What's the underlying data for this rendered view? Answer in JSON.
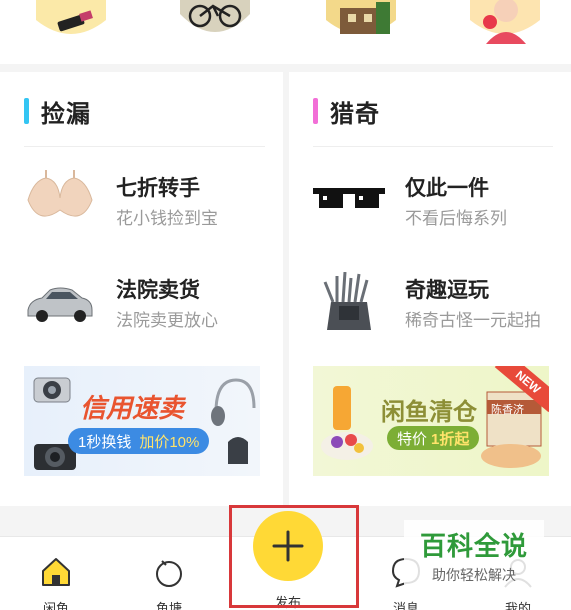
{
  "sections": {
    "left": {
      "title": "捡漏",
      "accent": "#33c5f3",
      "items": [
        {
          "title": "七折转手",
          "subtitle": "花小钱捡到宝"
        },
        {
          "title": "法院卖货",
          "subtitle": "法院卖更放心"
        }
      ],
      "banner": {
        "title": "信用速卖",
        "pill": "1秒换钱",
        "pill_extra": "加价10%"
      }
    },
    "right": {
      "title": "猎奇",
      "accent": "#f26fd7",
      "items": [
        {
          "title": "仅此一件",
          "subtitle": "不看后悔系列"
        },
        {
          "title": "奇趣逗玩",
          "subtitle": "稀奇古怪一元起拍"
        }
      ],
      "banner": {
        "title": "闲鱼清仓",
        "pill_prefix": "特价",
        "pill_highlight": "1折起",
        "corner": "NEW",
        "box_label": "陈香济"
      }
    }
  },
  "tabs": {
    "home": "闲鱼",
    "pond": "鱼塘",
    "publish": "发布",
    "messages": "消息",
    "mine": "我的"
  },
  "watermark": {
    "title": "百科全说",
    "subtitle": "助你轻松解决"
  },
  "colors": {
    "brand_yellow": "#ffd936",
    "highlight_red": "#d8383a",
    "watermark_green": "#2f9a3a"
  }
}
